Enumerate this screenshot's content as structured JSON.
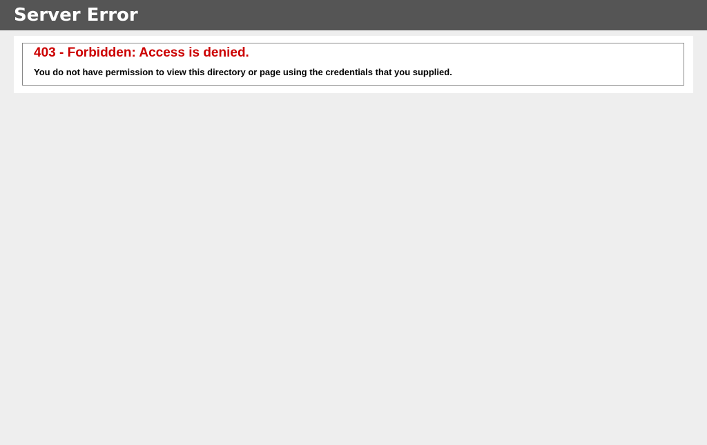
{
  "header": {
    "title": "Server Error"
  },
  "content": {
    "heading": "403 - Forbidden: Access is denied.",
    "message": "You do not have permission to view this directory or page using the credentials that you supplied."
  },
  "colors": {
    "header_bg": "#555555",
    "page_bg": "#EEEEEE",
    "heading": "#CC0000",
    "text": "#000000"
  }
}
